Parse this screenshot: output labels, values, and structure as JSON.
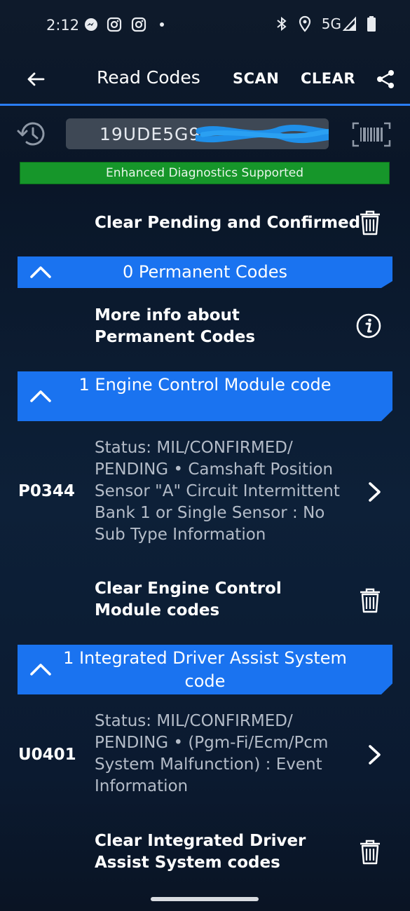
{
  "status_bar": {
    "time": "2:12",
    "network": "5G",
    "icons": [
      "messenger-icon",
      "instagram-icon",
      "instagram-icon",
      "dot-icon",
      "bluetooth-icon",
      "location-icon",
      "signal-icon",
      "battery-icon"
    ]
  },
  "app_bar": {
    "title": "Read Codes",
    "scan_label": "SCAN",
    "clear_label": "CLEAR"
  },
  "vin": {
    "value": "19UDE5G9"
  },
  "enhanced_banner": "Enhanced Diagnostics Supported",
  "clear_all": {
    "label": "Clear Pending and Confirmed"
  },
  "sections": [
    {
      "title": "0 Permanent Codes",
      "info_label": "More info about Permanent Codes"
    },
    {
      "title": "1 Engine Control Module code",
      "code": "P0344",
      "description": "Status: MIL/CONFIRMED/ PENDING • Camshaft Position Sensor \"A\" Circuit Intermittent Bank 1 or Single Sensor : No Sub Type Information",
      "clear_label": "Clear Engine Control Module codes"
    },
    {
      "title": "1 Integrated Driver Assist System code",
      "code": "U0401",
      "description": "Status: MIL/CONFIRMED/ PENDING • (Pgm-Fi/Ecm/Pcm System Malfunction) : Event Information",
      "clear_label": "Clear Integrated Driver Assist System codes"
    }
  ],
  "colors": {
    "accent_blue": "#1a73f0",
    "banner_green": "#16962a",
    "background": "#0b1a30"
  }
}
